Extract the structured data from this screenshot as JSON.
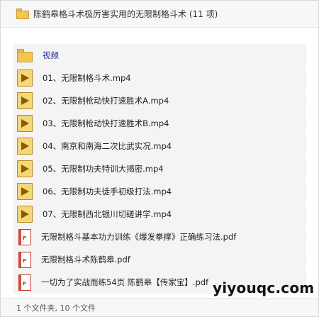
{
  "header": {
    "title": "陈鹤皋格斗术极厉害实用的无限制格斗术 (11 项)"
  },
  "items": [
    {
      "type": "folder",
      "label": "视频"
    },
    {
      "type": "video",
      "label": "01、无限制格斗术.mp4"
    },
    {
      "type": "video",
      "label": "02、无限制枪动快打速胜术A.mp4"
    },
    {
      "type": "video",
      "label": "03、无限制枪动快打速胜术B.mp4"
    },
    {
      "type": "video",
      "label": "04、南京和南海二次比武实况.mp4"
    },
    {
      "type": "video",
      "label": "05、无限制功夫特训大揭密.mp4"
    },
    {
      "type": "video",
      "label": "06、无限制功夫徒手初级打法.mp4"
    },
    {
      "type": "video",
      "label": "07、无限制西北银川切磋讲学.mp4"
    },
    {
      "type": "pdf",
      "label": "无限制格斗基本功力训练《爆发拳撑》正确练习法.pdf"
    },
    {
      "type": "pdf",
      "label": "无限制格斗术陈鹤皋.pdf"
    },
    {
      "type": "pdf",
      "label": "一切为了实战而练54页 陈鹤皋【传家宝】.pdf"
    }
  ],
  "footer": {
    "status": "1 个文件夹, 10 个文件"
  },
  "watermark": "yiyouqc.com",
  "colors": {
    "folder": "#f5c552",
    "video_icon": "#f6d776",
    "pdf_accent": "#d64b3f",
    "row_shade": "#f4f4f4"
  }
}
